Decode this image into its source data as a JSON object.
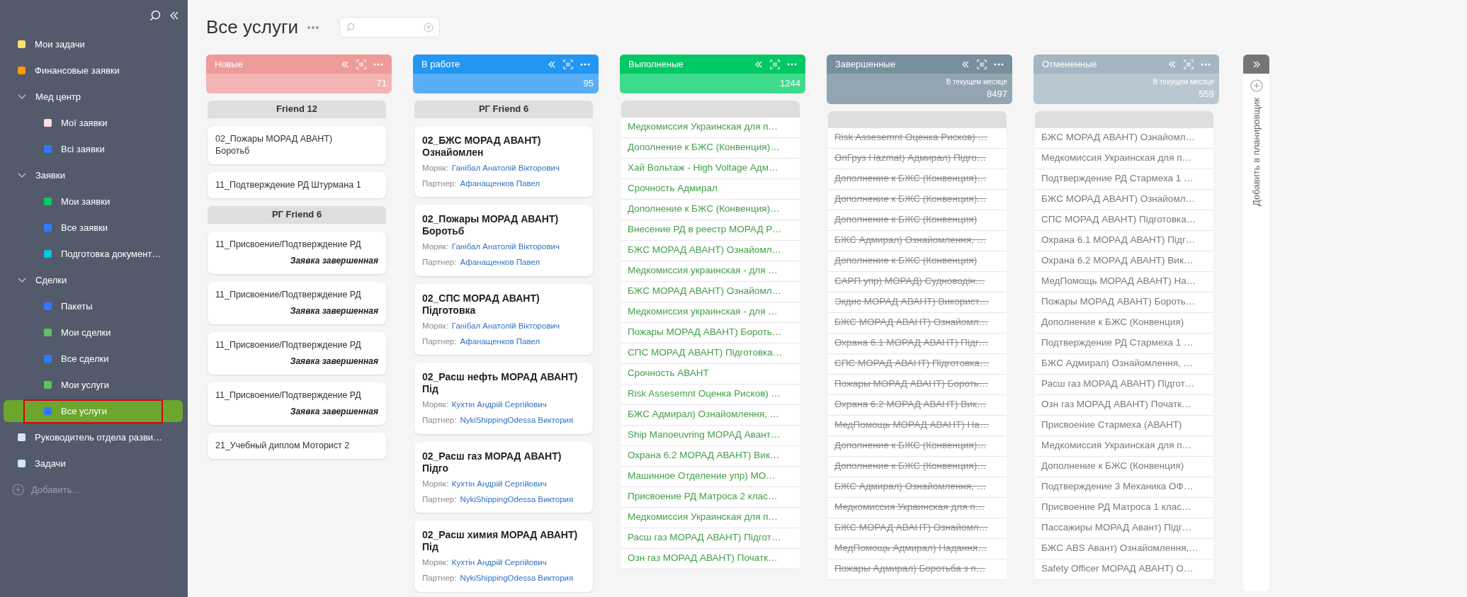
{
  "sidebar": {
    "items": [
      {
        "label": "Мои задачи",
        "color": "#ffe066",
        "selected": false
      },
      {
        "label": "Финансовые заявки",
        "color": "#ff9800",
        "selected": false
      },
      {
        "label": "Мед центр",
        "expanded": true,
        "selected": false,
        "children": [
          {
            "label": "Мої заявки",
            "color": "#fddde6",
            "selected": false
          },
          {
            "label": "Всі заявки",
            "color": "#2f7bff",
            "selected": false
          }
        ]
      },
      {
        "label": "Заявки",
        "expanded": true,
        "selected": false,
        "children": [
          {
            "label": "Мои заявки",
            "color": "#00cc66",
            "selected": false
          },
          {
            "label": "Все заявки",
            "color": "#2f7bff",
            "selected": false
          },
          {
            "label": "Подготовка документ…",
            "color": "#00c8dc",
            "selected": false
          }
        ]
      },
      {
        "label": "Сделки",
        "expanded": true,
        "selected": false,
        "children": [
          {
            "label": "Пакеты",
            "color": "#2f7bff",
            "selected": false
          },
          {
            "label": "Мои сделки",
            "color": "#5cc45c",
            "selected": false
          },
          {
            "label": "Все сделки",
            "color": "#2f7bff",
            "selected": false
          },
          {
            "label": "Мои услуги",
            "color": "#5cc45c",
            "selected": false
          },
          {
            "label": "Все услуги",
            "color": "#2f7bff",
            "selected": true
          }
        ]
      },
      {
        "label": "Руководитель отдела разви…",
        "color": "#cfe6ff",
        "selected": false
      },
      {
        "label": "Задачи",
        "color": "#cfe6ff",
        "selected": false
      }
    ],
    "add_label": "Добавить..."
  },
  "page": {
    "title": "Все услуги"
  },
  "columns": [
    {
      "title": "Новые",
      "color": "#ef9a9a",
      "count": "71",
      "kind": "brief",
      "groups": [
        {
          "title": "Friend 12",
          "cards": [
            {
              "text": "02_Пожары МОРАД АВАНТ) Боротьб"
            },
            {
              "text": "11_Подтверждение РД Штурмана 1"
            }
          ]
        },
        {
          "title": "РГ Friend 6",
          "cards": [
            {
              "text": "11_Присвоение/Подтверждение РД",
              "status": "Заявка завершенная"
            },
            {
              "text": "11_Присвоение/Подтверждение РД",
              "status": "Заявка завершенная"
            },
            {
              "text": "11_Присвоение/Подтверждение РД",
              "status": "Заявка завершенная"
            },
            {
              "text": "11_Присвоение/Подтверждение РД",
              "status": "Заявка завершенная"
            },
            {
              "text": "21_Учебный диплом Моторист 2"
            }
          ]
        }
      ]
    },
    {
      "title": "В работе",
      "color": "#2196f3",
      "count": "95",
      "kind": "detailed",
      "groups": [
        {
          "title": "РГ Friend 6",
          "cards": [
            {
              "text": "02_БЖС МОРАД АВАНТ) Ознайомлен",
              "fields": [
                {
                  "label": "Моряк:",
                  "value": "Ганібал Анатолій Вікторович"
                },
                {
                  "label": "Партнер:",
                  "value": "Афанащенков Павел"
                }
              ]
            },
            {
              "text": "02_Пожары МОРАД АВАНТ) Боротьб",
              "fields": [
                {
                  "label": "Моряк:",
                  "value": "Ганібал Анатолій Вікторович"
                },
                {
                  "label": "Партнер:",
                  "value": "Афанащенков Павел"
                }
              ]
            },
            {
              "text": "02_СПС МОРАД АВАНТ) Підготовка",
              "fields": [
                {
                  "label": "Моряк:",
                  "value": "Ганібал Анатолій Вікторович"
                },
                {
                  "label": "Партнер:",
                  "value": "Афанащенков Павел"
                }
              ]
            },
            {
              "text": "02_Расш нефть МОРАД АВАНТ) Під",
              "fields": [
                {
                  "label": "Моряк:",
                  "value": "Кухтін Андрій Сергійович"
                },
                {
                  "label": "Партнер:",
                  "value": "NykiShippingOdessa Виктория"
                }
              ]
            },
            {
              "text": "02_Расш газ МОРАД АВАНТ) Підго",
              "fields": [
                {
                  "label": "Моряк:",
                  "value": "Кухтін Андрій Сергійович"
                },
                {
                  "label": "Партнер:",
                  "value": "NykiShippingOdessa Виктория"
                }
              ]
            },
            {
              "text": "02_Расш химия МОРАД АВАНТ) Під",
              "fields": [
                {
                  "label": "Моряк:",
                  "value": "Кухтін Андрій Сергійович"
                },
                {
                  "label": "Партнер:",
                  "value": "NykiShippingOdessa Виктория"
                }
              ]
            }
          ]
        }
      ]
    },
    {
      "title": "Выполненые",
      "color": "#00c864",
      "count": "1244",
      "kind": "greenlist",
      "rows": [
        "Медкомиссия Украинская для п…",
        "Дополнение к БЖС (Конвенция)…",
        "Хай Вольтаж - High Voltage Адм…",
        "Срочность Адмирал",
        "Дополнение к БЖС (Конвенция)…",
        "Внесение РД в реестр МОРАД Р…",
        "БЖС МОРАД АВАНТ) Ознайомл…",
        "Медкомиссия украинская - для …",
        "БЖС МОРАД АВАНТ) Ознайомл…",
        "Медкомиссия украинская - для …",
        "Пожары МОРАД АВАНТ) Бороть…",
        "СПС МОРАД АВАНТ) Підготовка…",
        "Срочность АВАНТ",
        "Risk Assesemnt Оценка Рисков) …",
        "БЖС Адмирал) Ознайомлення, …",
        "Ship Manoeuvring МОРАД Авант…",
        "Охрана 6.2 МОРАД АВАНТ) Вик…",
        "Машинное Отделение упр) МО…",
        "Присвоение РД Матроса 2 клас…",
        "Медкомиссия Украинская для п…",
        "Расш газ МОРАД АВАНТ) Підгот…",
        "Озн газ МОРАД АВАНТ) Початк…"
      ]
    },
    {
      "title": "Завершенные",
      "color": "#78909c",
      "subtitle": "В текущем месяце",
      "count": "8497",
      "kind": "struck",
      "rows": [
        "Risk Assesemnt Оценка Рисков) …",
        "ОпГруз Hazmat) Адмирал) Підго…",
        "Дополнение к БЖС (Конвенция)…",
        "Дополнение к БЖС (Конвенция)…",
        "Дополнение к БЖС (Конвенция)",
        "БЖС Адмирал) Ознайомлення, …",
        "Дополнение к БЖС (Конвенция)",
        "САРП упр) МОРАД) Судноводін…",
        "Экдис МОРАД АВАНТ) Використ…",
        "БЖС МОРАД АВАНТ) Ознайомл…",
        "Охрана 6.1 МОРАД АВАНТ) Підг…",
        "СПС МОРАД АВАНТ) Підготовка…",
        "Пожары МОРАД АВАНТ) Бороть…",
        "Охрана 6.2 МОРАД АВАНТ) Вик…",
        "МедПомощь МОРАД АВАНТ) На…",
        "Дополнение к БЖС (Конвенция)…",
        "Дополнение к БЖС (Конвенция)…",
        "БЖС Адмирал) Ознайомлення, …",
        "Медкомиссия Украинская для п…",
        "БЖС МОРАД АВАНТ) Ознайомл…",
        "МедПомощь Адмирал) Надання…",
        "Пожары Адмирал) Боротьба з п…"
      ]
    },
    {
      "title": "Отмененные",
      "color": "#a4b6c1",
      "subtitle": "В текущем месяце",
      "count": "559",
      "kind": "plainlist",
      "rows": [
        "БЖС МОРАД АВАНТ) Ознайомл…",
        "Медкомиссия Украинская для п…",
        "Подтверждение РД Стармеха 1 …",
        "БЖС МОРАД АВАНТ) Ознайомл…",
        "СПС МОРАД АВАНТ) Підготовка…",
        "Охрана 6.1 МОРАД АВАНТ) Підг…",
        "Охрана 6.2 МОРАД АВАНТ) Вик…",
        "МедПомощь МОРАД АВАНТ) На…",
        "Пожары МОРАД АВАНТ) Бороть…",
        "Дополнение к БЖС (Конвенция)",
        "Подтверждение РД Стармеха 1 …",
        "БЖС Адмирал) Ознайомлення, …",
        "Расш газ МОРАД АВАНТ) Підгот…",
        "Озн газ МОРАД АВАНТ) Початк…",
        "Присвоение Стармеха (АВАНТ)",
        "Медкомиссия Украинская для п…",
        "Дополнение к БЖС (Конвенция)",
        "Подтверждение 3 Механика ОФ…",
        "Присвоение РД Матроса 1 клас…",
        "Пассажиры МОРАД Авант) Підг…",
        "БЖС ABS Авант) Ознайомлення,…",
        "Safety Officer МОРАД АВАНТ) О…"
      ]
    }
  ],
  "planner": {
    "label": "Добавить в планировщик"
  }
}
